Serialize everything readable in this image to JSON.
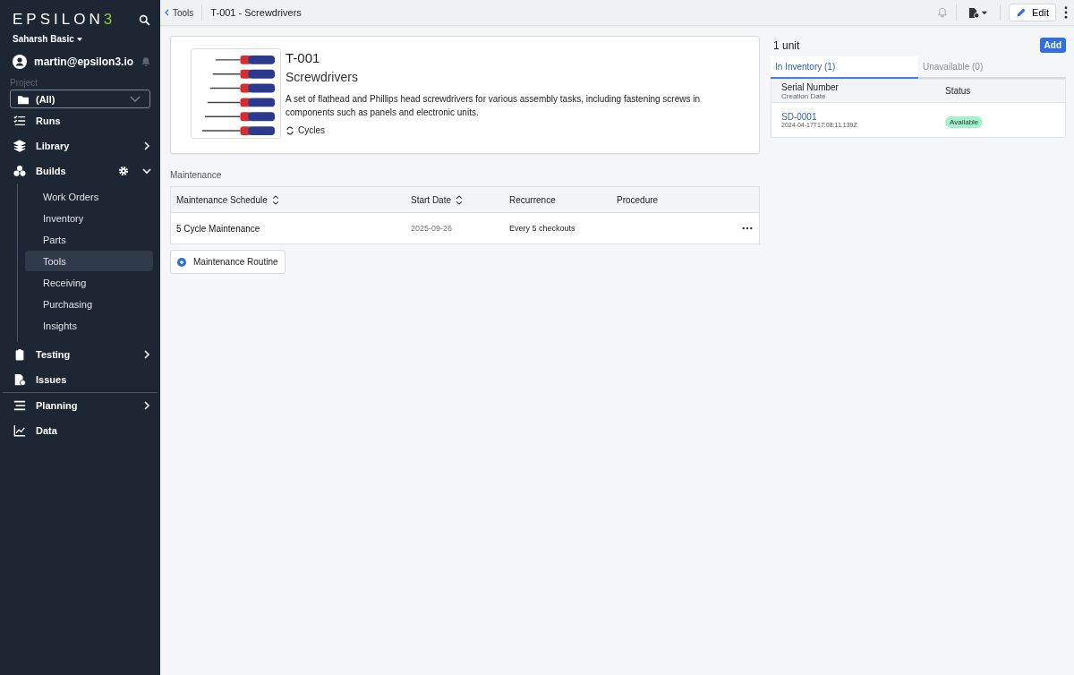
{
  "sidebar": {
    "logo": {
      "text": "EPSILON",
      "suffix": "3"
    },
    "workspace": "Saharsh Basic",
    "user": "martin@epsilon3.io",
    "project": {
      "label": "Project",
      "value": "(All)"
    },
    "items": [
      {
        "label": "Runs"
      },
      {
        "label": "Library",
        "expanded": false
      },
      {
        "label": "Builds",
        "expanded": true,
        "children": [
          {
            "label": "Work Orders",
            "selected": false
          },
          {
            "label": "Inventory",
            "selected": false
          },
          {
            "label": "Parts",
            "selected": false
          },
          {
            "label": "Tools",
            "selected": true
          },
          {
            "label": "Receiving",
            "selected": false
          },
          {
            "label": "Purchasing",
            "selected": false
          },
          {
            "label": "Insights",
            "selected": false
          }
        ]
      },
      {
        "label": "Testing",
        "expanded": false
      },
      {
        "label": "Issues"
      },
      {
        "label": "Planning",
        "expanded": false
      },
      {
        "label": "Data"
      }
    ]
  },
  "topbar": {
    "back": "Tools",
    "title": "T-001 - Screwdrivers",
    "edit": "Edit"
  },
  "tool": {
    "code": "T-001",
    "name": "Screwdrivers",
    "description": "A set of flathead and Phillips head screwdrivers for various assembly tasks, including fastening screws in components such as panels and electronic units.",
    "tag": "Cycles"
  },
  "maintenance": {
    "heading": "Maintenance",
    "columns": [
      {
        "label": "Maintenance Schedule",
        "sortable": true
      },
      {
        "label": "Start Date",
        "sortable": true
      },
      {
        "label": "Recurrence",
        "sortable": false
      },
      {
        "label": "Procedure",
        "sortable": false
      }
    ],
    "rows": [
      {
        "schedule": "5 Cycle Maintenance",
        "start_date": "2025-09-26",
        "recurrence": "Every 5 checkouts"
      }
    ],
    "add_button": "Maintenance Routine"
  },
  "units": {
    "count": "1 unit",
    "add": "Add",
    "tabs": [
      {
        "label": "In Inventory (1)",
        "selected": true
      },
      {
        "label": "Unavailable (0)",
        "selected": false
      }
    ],
    "columns": {
      "serial": "Serial Number",
      "date": "Creation Date",
      "status": "Status"
    },
    "rows": [
      {
        "serial": "SD-0001",
        "date": "2024-04-17T17:08:11.139Z",
        "status": "Available",
        "color": "#a7f0cf"
      }
    ]
  }
}
